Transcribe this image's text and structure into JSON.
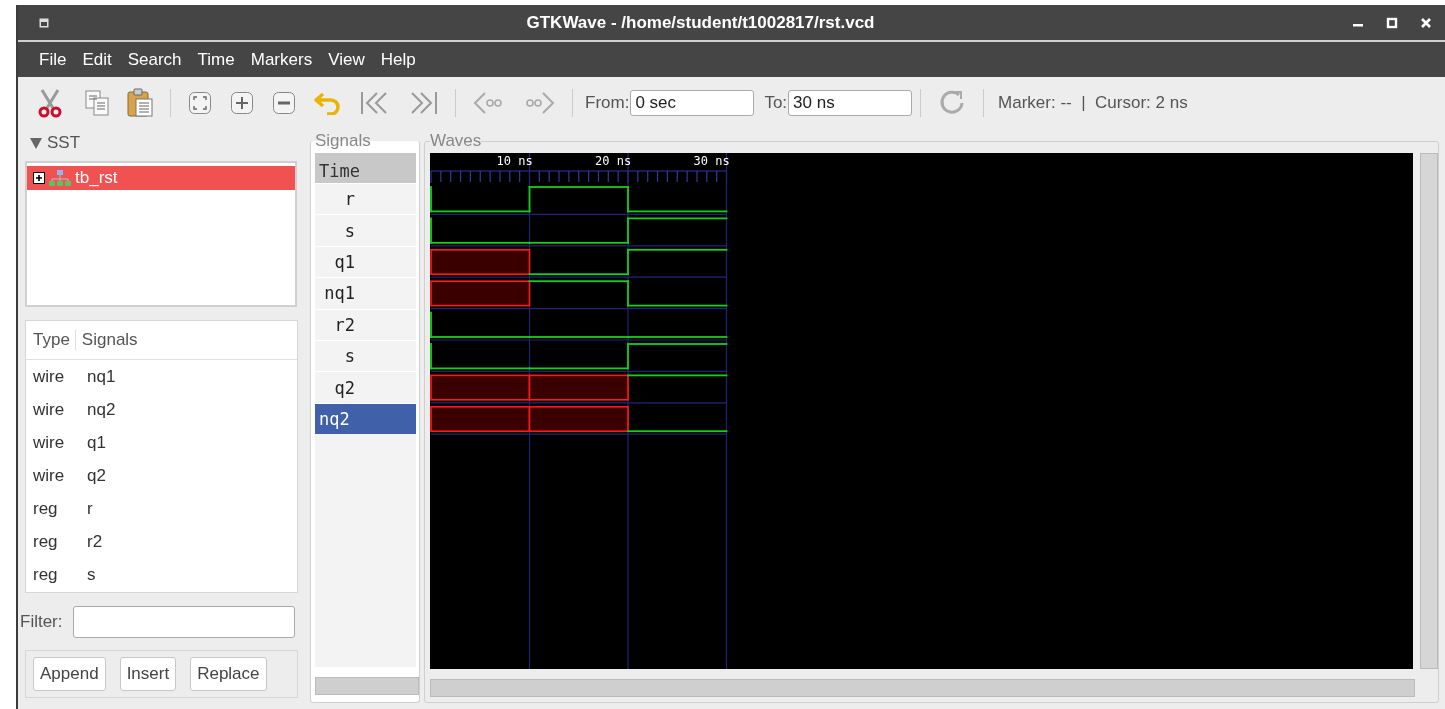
{
  "window": {
    "title": "GTKWave - /home/student/t1002817/rst.vcd"
  },
  "menu": [
    "File",
    "Edit",
    "Search",
    "Time",
    "Markers",
    "View",
    "Help"
  ],
  "toolbar": {
    "from_label": "From:",
    "from_value": "0 sec",
    "to_label": "To:",
    "to_value": "30 ns",
    "status": "Marker: --  |  Cursor: 2 ns"
  },
  "sst": {
    "title": "SST",
    "expanded": true,
    "tree": [
      {
        "label": "tb_rst",
        "selected": true,
        "expanded": false
      }
    ]
  },
  "signal_list": {
    "columns": [
      "Type",
      "Signals"
    ],
    "rows": [
      {
        "type": "wire",
        "signal": "nq1"
      },
      {
        "type": "wire",
        "signal": "nq2"
      },
      {
        "type": "wire",
        "signal": "q1"
      },
      {
        "type": "wire",
        "signal": "q2"
      },
      {
        "type": "reg",
        "signal": "r"
      },
      {
        "type": "reg",
        "signal": "r2"
      },
      {
        "type": "reg",
        "signal": "s"
      }
    ]
  },
  "filter": {
    "label": "Filter:"
  },
  "buttons": [
    "Append",
    "Insert",
    "Replace"
  ],
  "signals_pane": {
    "title": "Signals",
    "header": "Time",
    "rows": [
      {
        "name": "r",
        "selected": false
      },
      {
        "name": "s",
        "selected": false
      },
      {
        "name": "q1",
        "selected": false
      },
      {
        "name": "nq1",
        "selected": false
      },
      {
        "name": "r2",
        "selected": false
      },
      {
        "name": "s",
        "selected": false
      },
      {
        "name": "q2",
        "selected": false
      },
      {
        "name": "nq2",
        "selected": true
      }
    ]
  },
  "waves": {
    "title": "Waves",
    "time_labels": [
      "10 ns",
      "20 ns",
      "30 ns"
    ],
    "traces": [
      {
        "segments": [
          {
            "unknown": false,
            "high": false
          },
          {
            "unknown": false,
            "high": true
          },
          {
            "unknown": false,
            "high": false
          }
        ]
      },
      {
        "segments": [
          {
            "unknown": false,
            "high": false
          },
          {
            "unknown": false,
            "high": false
          },
          {
            "unknown": false,
            "high": true
          }
        ]
      },
      {
        "segments": [
          {
            "unknown": true
          },
          {
            "unknown": false,
            "high": false
          },
          {
            "unknown": false,
            "high": true
          }
        ]
      },
      {
        "segments": [
          {
            "unknown": true
          },
          {
            "unknown": false,
            "high": true
          },
          {
            "unknown": false,
            "high": false
          }
        ]
      },
      {
        "segments": [
          {
            "unknown": false,
            "high": false
          },
          {
            "unknown": false,
            "high": false
          },
          {
            "unknown": false,
            "high": false
          }
        ]
      },
      {
        "segments": [
          {
            "unknown": false,
            "high": false
          },
          {
            "unknown": false,
            "high": false
          },
          {
            "unknown": false,
            "high": true
          }
        ]
      },
      {
        "segments": [
          {
            "unknown": true
          },
          {
            "unknown": true
          },
          {
            "unknown": false,
            "high": true
          }
        ]
      },
      {
        "segments": [
          {
            "unknown": true
          },
          {
            "unknown": true
          },
          {
            "unknown": false,
            "high": false
          }
        ]
      }
    ]
  }
}
